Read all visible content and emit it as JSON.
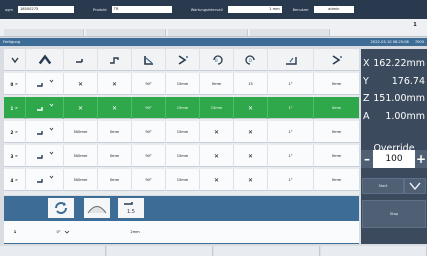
{
  "topbar": {
    "fields": [
      {
        "label": "ogm",
        "value": "18500275"
      },
      {
        "label": "Produkt",
        "value": "TR"
      },
      {
        "label": "Wartungsintervall",
        "value": "1 mm"
      },
      {
        "label": "Benutzer",
        "value": "admin"
      }
    ]
  },
  "page": {
    "number": "1"
  },
  "strip": {
    "section": "Fertigung",
    "datetime": "2022-03-10 08:25:06",
    "code": "7000"
  },
  "table": {
    "header_icons": [
      "up-arrow-icon",
      "bend-down-icon",
      "bend-up-icon",
      "angle-icon",
      "flange-icon",
      "rotate-icon",
      "rotate-back-icon",
      "stack-icon",
      "more-icon"
    ],
    "rows": [
      {
        "no": "0",
        "sub": "0°",
        "cells": [
          "",
          "✕",
          "✕",
          "90°",
          "15mm",
          "0mm",
          "15",
          "1°",
          "0mm"
        ],
        "active": false
      },
      {
        "no": "1",
        "sub": "0°",
        "cells": [
          "",
          "✕",
          "✕",
          "90°",
          "15mm",
          "15mm",
          "✕",
          "1°",
          "0mm"
        ],
        "active": true
      },
      {
        "no": "2",
        "sub": "0°",
        "cells": [
          "",
          "500mm",
          "0mm",
          "90°",
          "15mm",
          "✕",
          "✕",
          "1°",
          "0mm"
        ],
        "active": false
      },
      {
        "no": "3",
        "sub": "0°",
        "cells": [
          "",
          "500mm",
          "0mm",
          "90°",
          "15mm",
          "✕",
          "✕",
          "1°",
          "0mm"
        ],
        "active": false
      },
      {
        "no": "4",
        "sub": "0°",
        "cells": [
          "",
          "500mm",
          "0mm",
          "90°",
          "15mm",
          "✕",
          "✕",
          "1°",
          "0mm"
        ],
        "active": false
      }
    ]
  },
  "tools": {
    "header_icons": [
      "refresh-icon",
      "die-icon",
      "ratio-icon"
    ],
    "row": {
      "no": "1",
      "angle": "0°",
      "value": "2mm"
    }
  },
  "coords": [
    {
      "axis": "X",
      "value": "162.22mm"
    },
    {
      "axis": "Y",
      "value": "176.74"
    },
    {
      "axis": "Z",
      "value": "151.00mm"
    },
    {
      "axis": "A",
      "value": "1.00mm"
    }
  ],
  "override": {
    "label": "Override",
    "value": "100",
    "minus": "–",
    "plus": "+"
  },
  "buttons": {
    "start": "Start",
    "stop": "Stop"
  },
  "colors": {
    "active_row": "#2ea84a",
    "panel": "#3b4a5c",
    "strip": "#3d6d96"
  }
}
